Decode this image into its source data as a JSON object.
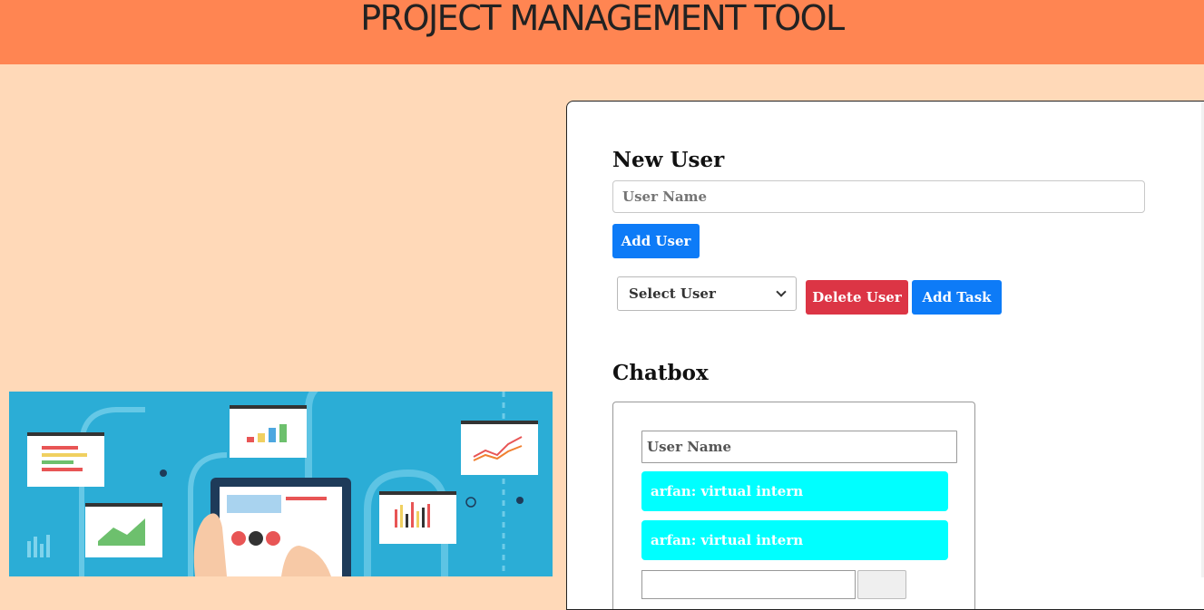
{
  "header": {
    "title": "PROJECT MANAGEMENT TOOL"
  },
  "new_user": {
    "heading": "New User",
    "name_placeholder": "User Name",
    "add_button": "Add User"
  },
  "user_actions": {
    "select_label": "Select User",
    "delete_button": "Delete User",
    "add_task_button": "Add Task"
  },
  "chatbox": {
    "heading": "Chatbox",
    "name_placeholder": "User Name",
    "messages": [
      {
        "text": "arfan: virtual intern"
      },
      {
        "text": "arfan: virtual intern"
      }
    ]
  },
  "colors": {
    "header_bg": "#ff8552",
    "page_bg": "#ffd9b8",
    "primary": "#0d7bf7",
    "danger": "#dc3545",
    "message_bg": "#00ffff"
  }
}
